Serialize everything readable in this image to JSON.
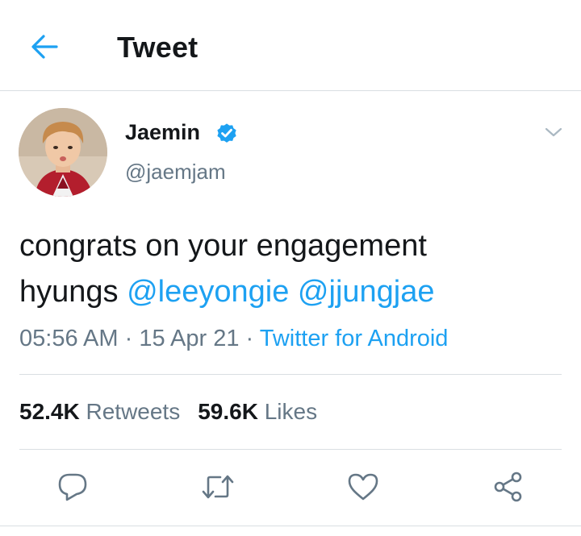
{
  "header": {
    "title": "Tweet",
    "back_icon": "arrow-left-icon"
  },
  "tweet": {
    "author": {
      "name": "Jaemin",
      "handle": "@jaemjam",
      "verified_icon": "verified-badge-icon"
    },
    "text": {
      "line1": "congrats on your engagement",
      "line2_prefix": "hyungs ",
      "mentions": [
        "@leeyongie",
        "@jjungjae"
      ]
    },
    "time": "05:56 AM",
    "date": "15 Apr 21",
    "separator": " · ",
    "source": "Twitter for Android",
    "stats": {
      "retweets_count": "52.4K",
      "retweets_label": " Retweets",
      "likes_count": "59.6K",
      "likes_label": " Likes"
    },
    "actions": [
      "reply-icon",
      "retweet-icon",
      "like-icon",
      "share-icon"
    ]
  },
  "colors": {
    "accent": "#1da1f2",
    "text": "#14171a",
    "secondary": "#657786",
    "divider": "#d9dee2"
  }
}
